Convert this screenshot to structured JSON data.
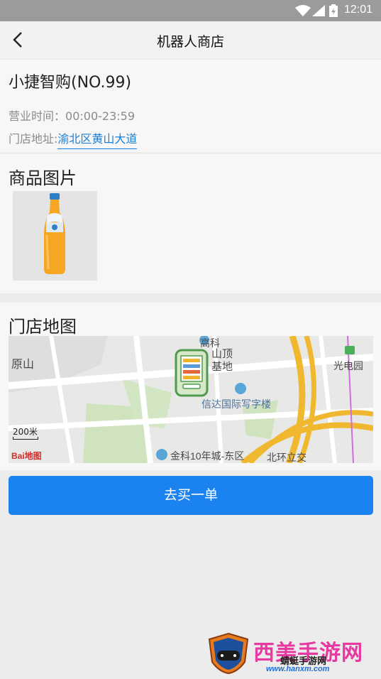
{
  "status_bar": {
    "time": "12:01"
  },
  "nav": {
    "title": "机器人商店"
  },
  "store": {
    "name": "小捷智购(NO.99)",
    "hours_label": "营业时间：",
    "hours_value": "00:00-23:59",
    "address_label": "门店地址:",
    "address_value": "渝北区黄山大道"
  },
  "goods": {
    "section_title": "商品图片"
  },
  "map": {
    "section_title": "门店地图",
    "labels": {
      "yuanshan": "原山",
      "gaoke": "高科",
      "shanding": "山顶",
      "jidi": "基地",
      "guangdianyuan": "光电园",
      "xinda": "信达国际写字楼",
      "jinke": "金科10年城-东区",
      "beihuan": "北环立交"
    },
    "scale": "200米",
    "provider": "Bai地图"
  },
  "actions": {
    "buy_label": "去买一单"
  },
  "watermark": {
    "title": "西美手游网",
    "subtitle": "蜻蜓手游网",
    "url": "www.hanxm.com"
  }
}
